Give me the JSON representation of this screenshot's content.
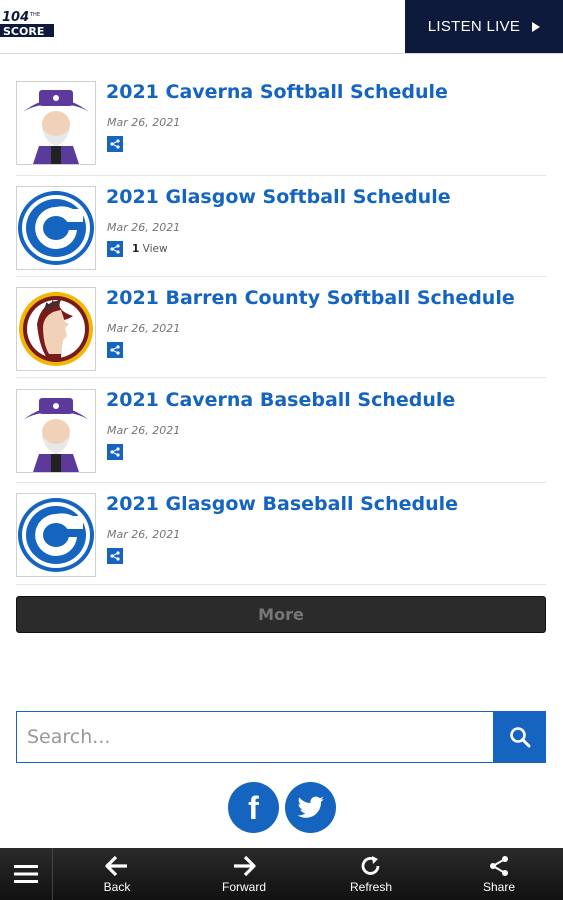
{
  "header": {
    "logo_text": "104 THE SCORE",
    "listen_live": "LISTEN LIVE"
  },
  "articles": [
    {
      "title": "2021 Caverna Softball Schedule",
      "date": "Mar 26, 2021",
      "thumb": "caverna-colonel-logo"
    },
    {
      "title": "2021 Glasgow Softball Schedule",
      "date": "Mar 26, 2021",
      "views_count": "1",
      "views_label": "View",
      "thumb": "glasgow-g-logo"
    },
    {
      "title": "2021 Barren County Softball Schedule",
      "date": "Mar 26, 2021",
      "thumb": "barren-county-trojan-logo"
    },
    {
      "title": "2021 Caverna Baseball Schedule",
      "date": "Mar 26, 2021",
      "thumb": "caverna-colonel-logo"
    },
    {
      "title": "2021 Glasgow Baseball Schedule",
      "date": "Mar 26, 2021",
      "thumb": "glasgow-g-logo"
    }
  ],
  "more_label": "More",
  "search": {
    "placeholder": "Search..."
  },
  "social": {
    "facebook": "f",
    "twitter": "twitter-bird-icon"
  },
  "toolbar": {
    "back": "Back",
    "forward": "Forward",
    "refresh": "Refresh",
    "share": "Share"
  },
  "colors": {
    "accent": "#1565c0",
    "header_dark": "#0e1a3c",
    "toolbar": "#1a1a1a"
  }
}
